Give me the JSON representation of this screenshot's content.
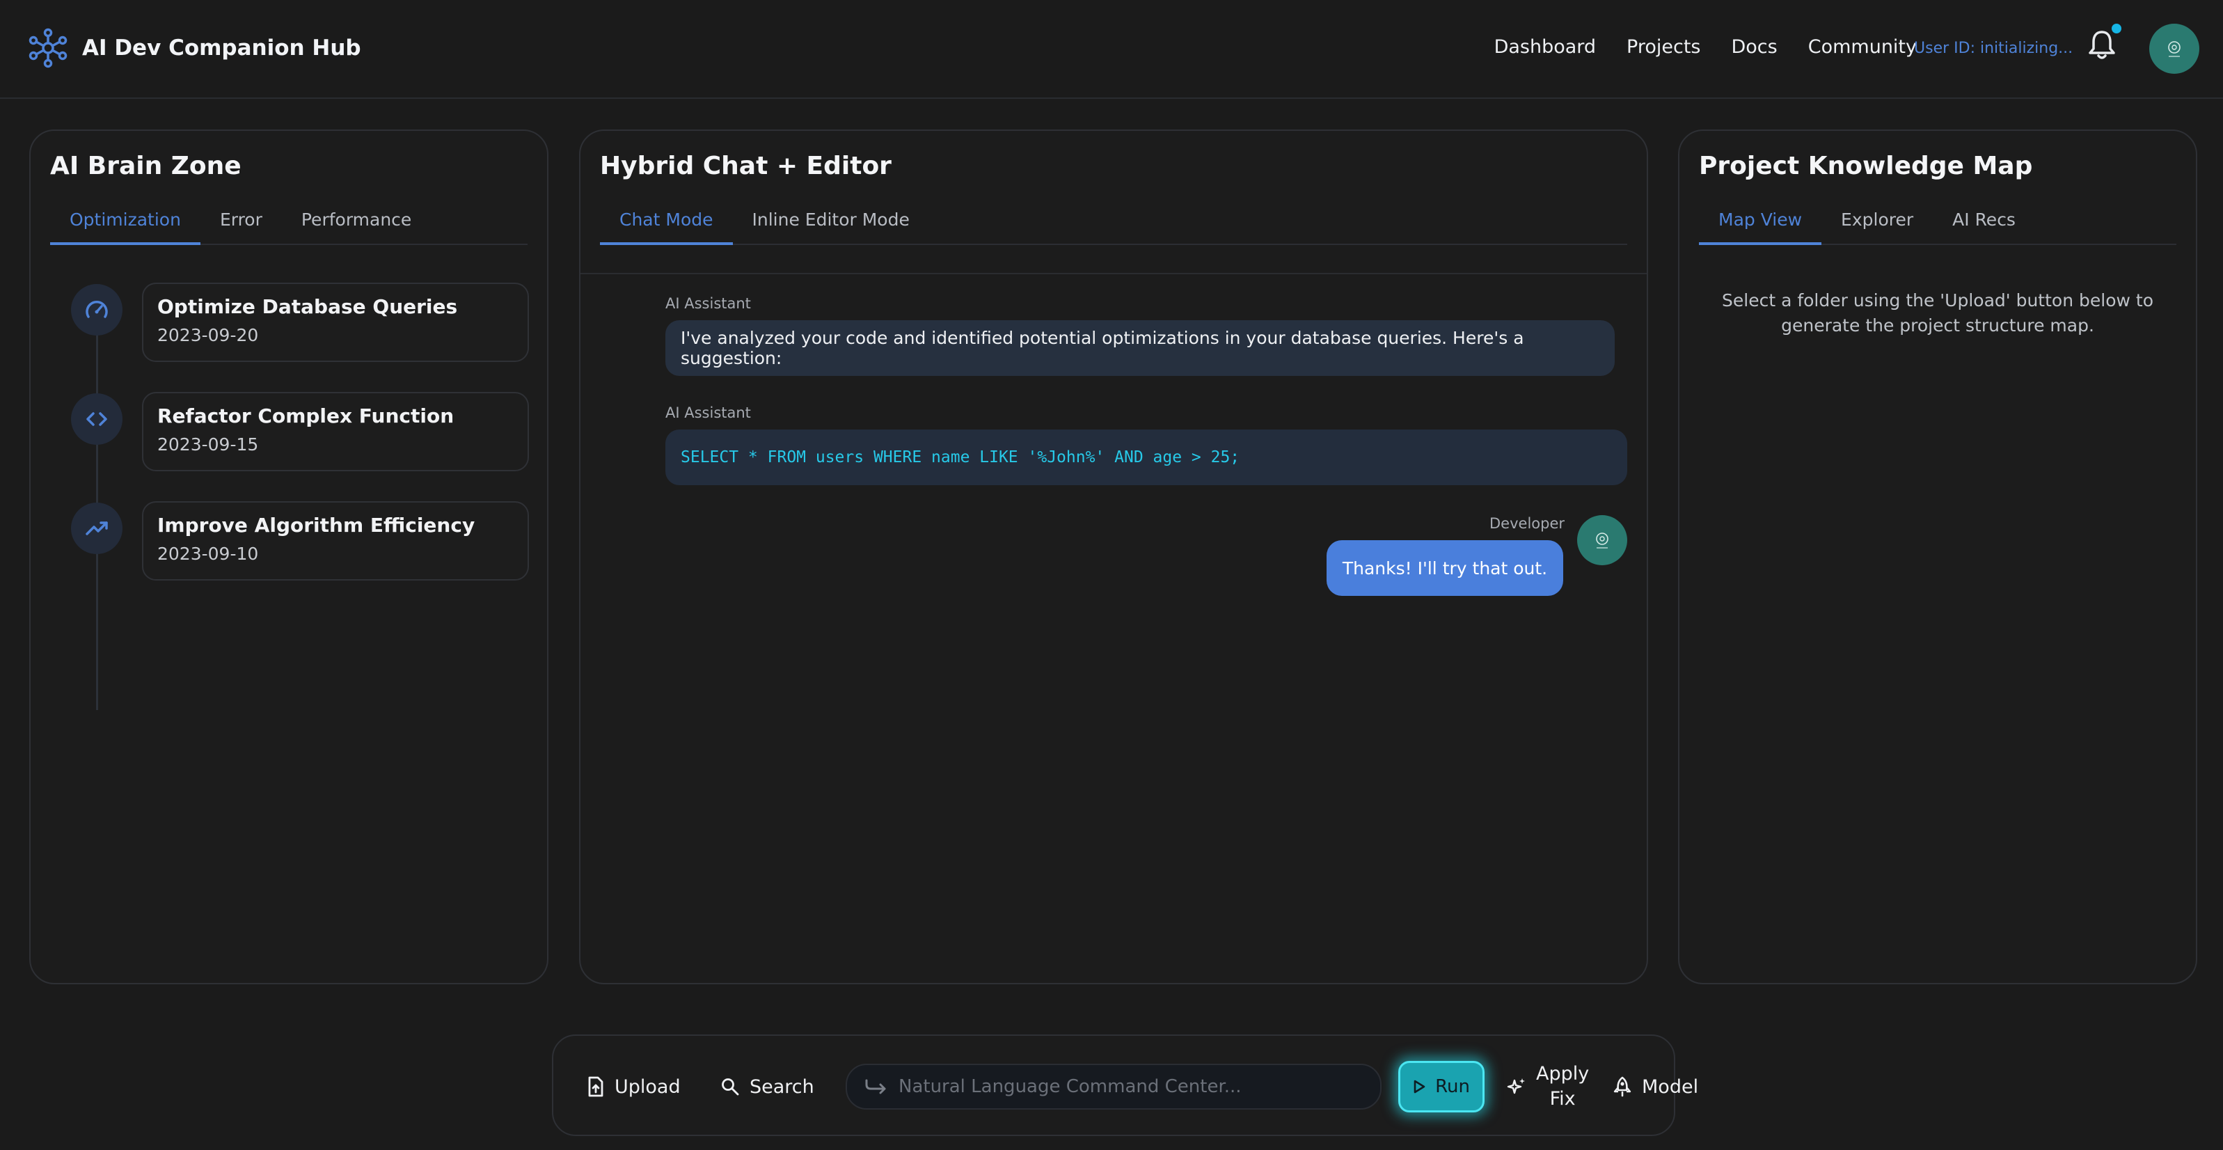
{
  "header": {
    "brand": "AI Dev Companion Hub",
    "nav": [
      "Dashboard",
      "Projects",
      "Docs",
      "Community"
    ],
    "user_id": "User ID: initializing..."
  },
  "left_panel": {
    "title": "AI Brain Zone",
    "tabs": [
      "Optimization",
      "Error",
      "Performance"
    ],
    "active_tab": "Optimization",
    "items": [
      {
        "title": "Optimize Database Queries",
        "date": "2023-09-20",
        "icon": "speedometer-icon"
      },
      {
        "title": "Refactor Complex Function",
        "date": "2023-09-15",
        "icon": "code-icon"
      },
      {
        "title": "Improve Algorithm Efficiency",
        "date": "2023-09-10",
        "icon": "trending-up-icon"
      }
    ]
  },
  "middle_panel": {
    "title": "Hybrid Chat + Editor",
    "tabs": [
      "Chat Mode",
      "Inline Editor Mode"
    ],
    "active_tab": "Chat Mode",
    "messages": [
      {
        "sender": "AI Assistant",
        "text": "I've analyzed your code and identified potential optimizations in your database queries. Here's a suggestion:"
      },
      {
        "sender": "AI Assistant",
        "code": "SELECT * FROM users WHERE name LIKE '%John%' AND age > 25;"
      },
      {
        "sender": "Developer",
        "text": "Thanks! I'll try that out."
      }
    ]
  },
  "right_panel": {
    "title": "Project Knowledge Map",
    "tabs": [
      "Map View",
      "Explorer",
      "AI Recs"
    ],
    "active_tab": "Map View",
    "hint": "Select a folder using the 'Upload' button below to generate the project structure map."
  },
  "command_bar": {
    "upload": "Upload",
    "search": "Search",
    "placeholder": "Natural Language Command Center...",
    "run": "Run",
    "apply_fix_line1": "Apply",
    "apply_fix_line2": "Fix",
    "model": "Model"
  },
  "colors": {
    "background": "#1b1b1b",
    "accent": "#4f83d8",
    "run_glow": "#4be6f2",
    "notification_dot": "#16b6e6",
    "avatar": "#2a7a70"
  }
}
